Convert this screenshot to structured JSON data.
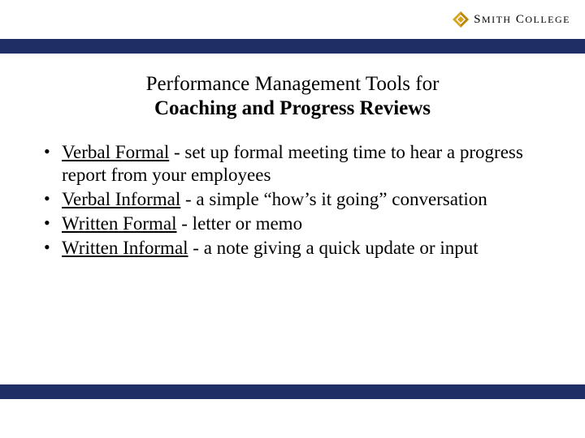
{
  "brand": {
    "name": "SMITH COLLEGE"
  },
  "colors": {
    "bar": "#1f2f66",
    "gold": "#d9a520",
    "gold_dark": "#b8860b"
  },
  "title": {
    "line1": "Performance Management Tools for",
    "line2": "Coaching and Progress Reviews"
  },
  "bullets": [
    {
      "term": "Verbal Formal",
      "rest": " - set up formal meeting time to hear a progress report from your employees"
    },
    {
      "term": "Verbal Informal",
      "rest": " - a simple “how’s it going” conversation"
    },
    {
      "term": "Written Formal",
      "rest": " - letter or memo"
    },
    {
      "term": "Written Informal",
      "rest": " - a note giving a quick update or input"
    }
  ]
}
